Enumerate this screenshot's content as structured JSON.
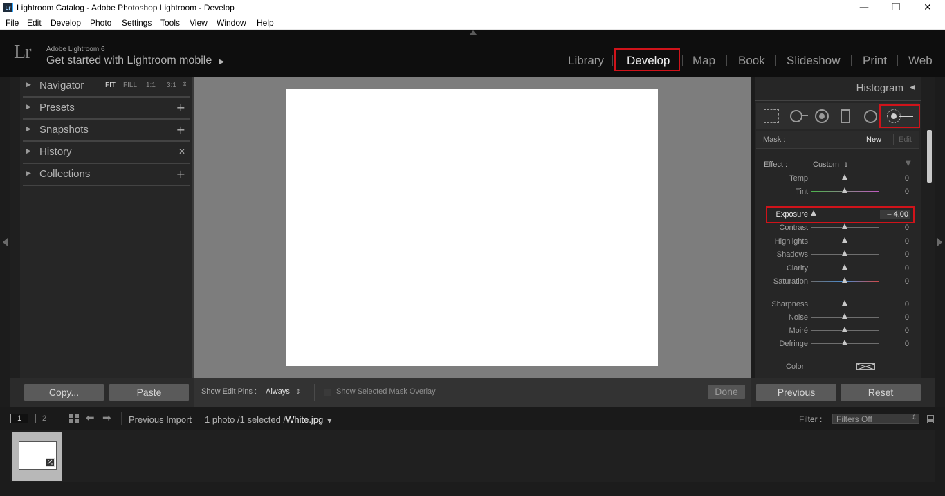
{
  "window": {
    "title": "Lightroom Catalog - Adobe Photoshop Lightroom - Develop",
    "app_icon": "Lr",
    "controls": {
      "minimize": "—",
      "restore": "❐",
      "close": "✕"
    }
  },
  "menu": [
    "File",
    "Edit",
    "Develop",
    "Photo",
    "Settings",
    "Tools",
    "View",
    "Window",
    "Help"
  ],
  "brand": {
    "logo": "Lr",
    "product": "Adobe Lightroom 6",
    "mobile_prompt": "Get started with Lightroom mobile",
    "mobile_arrow": "▶"
  },
  "modules": [
    "Library",
    "Develop",
    "Map",
    "Book",
    "Slideshow",
    "Print",
    "Web"
  ],
  "active_module": "Develop",
  "left_panel": {
    "navigator": {
      "label": "Navigator",
      "zoom": [
        "FIT",
        "FILL",
        "1:1",
        "3:1"
      ],
      "zoom_arrows": "⇕"
    },
    "sections": [
      {
        "label": "Presets",
        "action": "+"
      },
      {
        "label": "Snapshots",
        "action": "+"
      },
      {
        "label": "History",
        "action": "✕"
      },
      {
        "label": "Collections",
        "action": "+"
      }
    ],
    "copy_button": "Copy...",
    "paste_button": "Paste"
  },
  "center_toolbar": {
    "show_edit_pins_label": "Show Edit Pins :",
    "show_edit_pins_value": "Always",
    "mask_overlay_label": "Show Selected Mask Overlay",
    "done_button": "Done"
  },
  "right_panel": {
    "histogram_label": "Histogram",
    "mask": {
      "label": "Mask :",
      "new": "New",
      "edit": "Edit"
    },
    "effect": {
      "label": "Effect :",
      "value": "Custom"
    },
    "sliders_top": [
      {
        "name": "Temp",
        "value": "0",
        "pos": 0.5
      },
      {
        "name": "Tint",
        "value": "0",
        "pos": 0.5
      }
    ],
    "exposure": {
      "name": "Exposure",
      "value": "– 4.00",
      "pos": 0.04
    },
    "sliders_tone": [
      {
        "name": "Contrast",
        "value": "0",
        "pos": 0.5
      },
      {
        "name": "Highlights",
        "value": "0",
        "pos": 0.5
      },
      {
        "name": "Shadows",
        "value": "0",
        "pos": 0.5
      },
      {
        "name": "Clarity",
        "value": "0",
        "pos": 0.5
      },
      {
        "name": "Saturation",
        "value": "0",
        "pos": 0.5
      }
    ],
    "sliders_detail": [
      {
        "name": "Sharpness",
        "value": "0",
        "pos": 0.5
      },
      {
        "name": "Noise",
        "value": "0",
        "pos": 0.5
      },
      {
        "name": "Moiré",
        "value": "0",
        "pos": 0.5
      },
      {
        "name": "Defringe",
        "value": "0",
        "pos": 0.5
      }
    ],
    "color_label": "Color",
    "previous_button": "Previous",
    "reset_button": "Reset"
  },
  "filmstrip": {
    "screen1": "1",
    "screen2": "2",
    "source": "Previous Import",
    "selection": "1 photo /1 selected /",
    "filename": "White.jpg",
    "filter_label": "Filter :",
    "filter_value": "Filters Off"
  },
  "colors": {
    "highlight_box": "#d0131a",
    "panel_bg": "#262626",
    "center_bg": "#7d7d7d"
  }
}
